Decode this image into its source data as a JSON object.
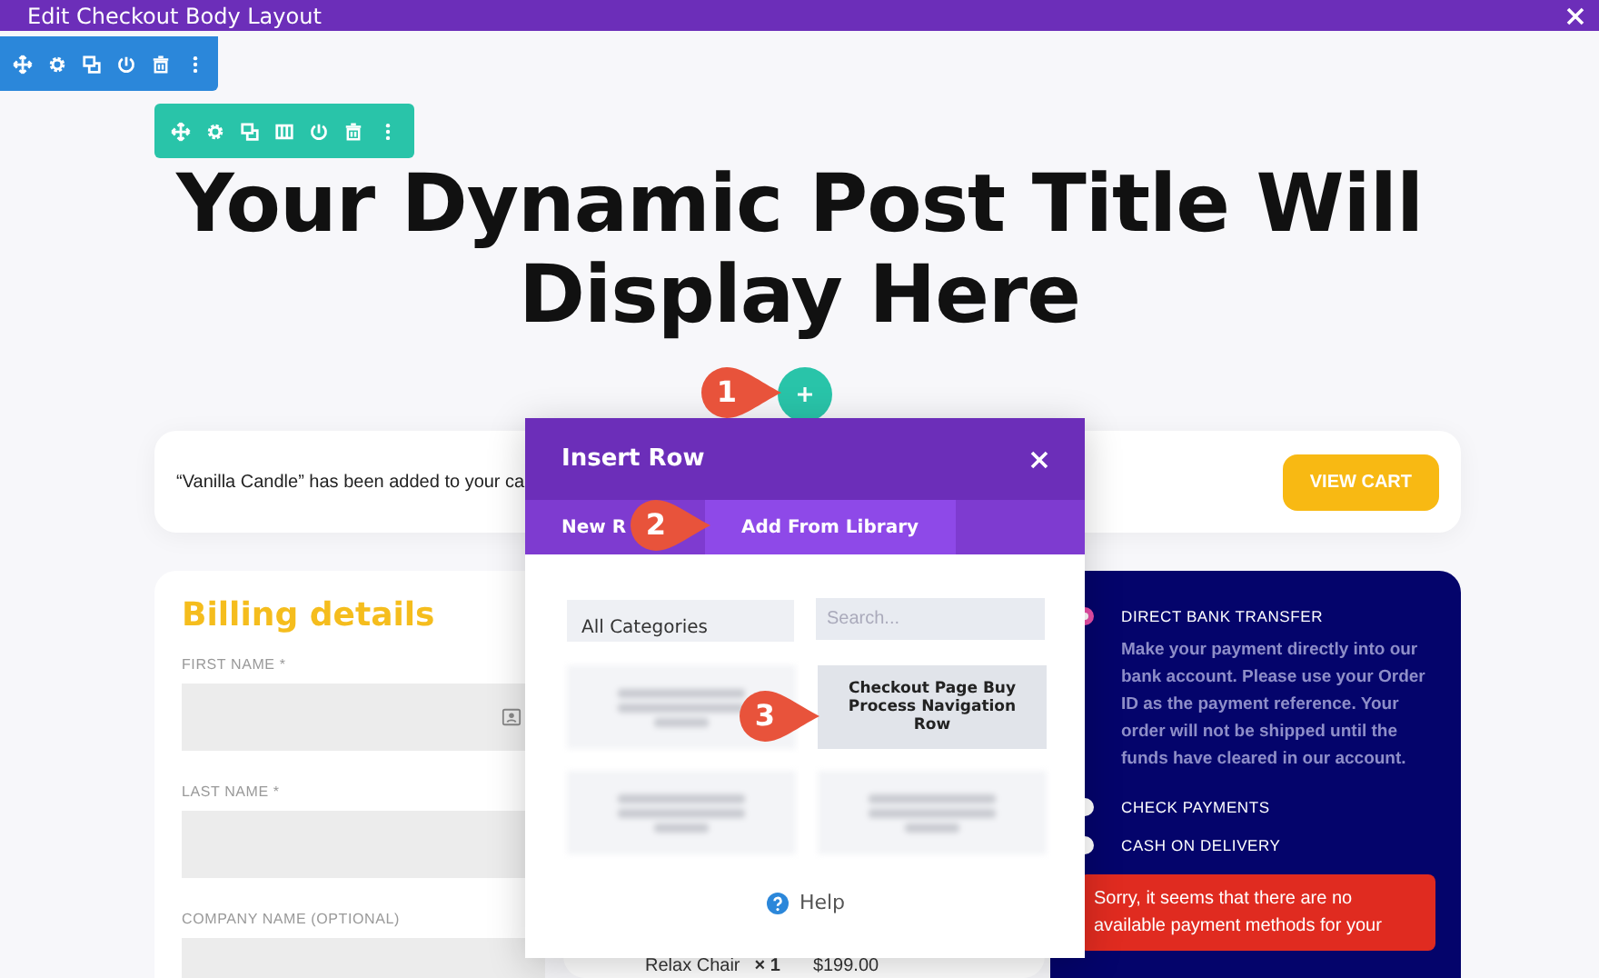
{
  "window": {
    "title": "Edit Checkout Body Layout"
  },
  "page_title": "Your Dynamic Post Title Will Display Here",
  "notice": {
    "text": "“Vanilla Candle” has been added to your ca",
    "button": "VIEW CART"
  },
  "billing": {
    "heading": "Billing details",
    "fields": [
      {
        "label": "FIRST NAME *",
        "contact_icon": true
      },
      {
        "label": "LAST NAME *",
        "contact_icon": false
      },
      {
        "label": "COMPANY NAME (OPTIONAL)",
        "contact_icon": false
      }
    ]
  },
  "order": {
    "item": "Relax Chair",
    "quantity": "× 1",
    "price": "$199.00"
  },
  "payment": {
    "methods": [
      {
        "label": "DIRECT BANK TRANSFER",
        "selected": true,
        "description": "Make your payment directly into our bank account. Please use your Order ID as the payment reference. Your order will not be shipped until the funds have cleared in our account."
      },
      {
        "label": "CHECK PAYMENTS",
        "selected": false
      },
      {
        "label": "CASH ON DELIVERY",
        "selected": false
      }
    ],
    "error": "Sorry, it seems that there are no available payment methods for your"
  },
  "modal": {
    "title": "Insert Row",
    "tabs": [
      {
        "label": "New R",
        "selected": false
      },
      {
        "label": "Add From Library",
        "selected": true
      }
    ],
    "category_select": "All Categories",
    "search_placeholder": "Search...",
    "layouts": [
      {
        "kind": "blurred",
        "hovered": false
      },
      {
        "kind": "named",
        "label": "Checkout Page Buy Process Navigation Row",
        "hovered": true
      },
      {
        "kind": "blurred",
        "hovered": false
      },
      {
        "kind": "blurred",
        "hovered": false
      }
    ],
    "help": "Help"
  },
  "callouts": [
    "1",
    "2",
    "3"
  ]
}
